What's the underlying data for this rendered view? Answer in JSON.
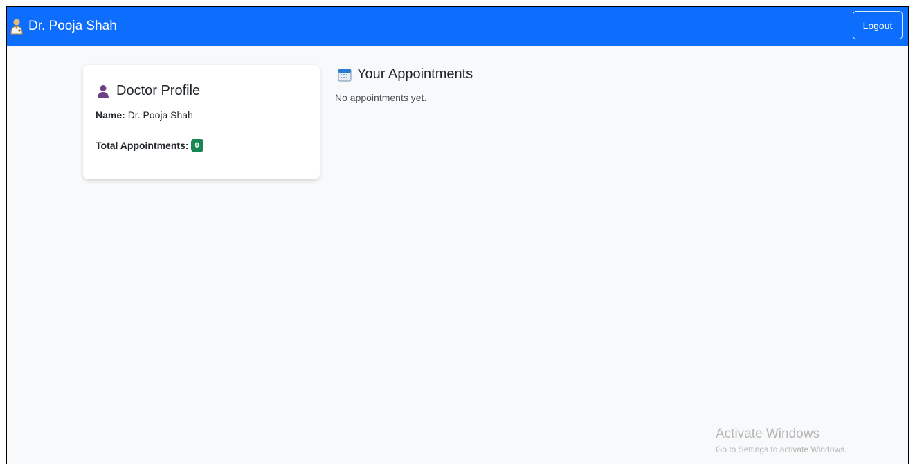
{
  "navbar": {
    "brand_text": "Dr. Pooja Shah",
    "brand_icon": "doctor-icon",
    "logout_label": "Logout",
    "color": "#0d6efd"
  },
  "profile": {
    "title": "Doctor Profile",
    "title_icon": "user-icon",
    "name_label": "Name:",
    "name_value": "Dr. Pooja Shah",
    "total_label": "Total Appointments:",
    "total_value": "0",
    "badge_color": "#198754"
  },
  "appointments": {
    "title": "Your Appointments",
    "title_icon": "calendar-icon",
    "empty_message": "No appointments yet."
  },
  "watermark": {
    "title": "Activate Windows",
    "subtitle": "Go to Settings to activate Windows."
  }
}
